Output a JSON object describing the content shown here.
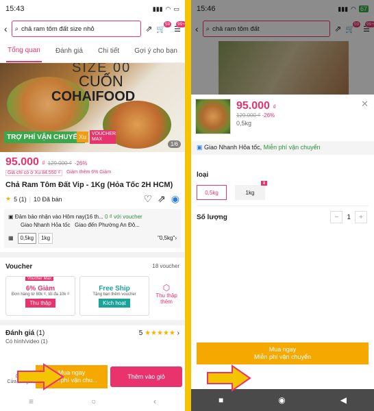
{
  "left": {
    "status_time": "15:43",
    "cart_badge": "59",
    "chat_badge": "99+",
    "search_text": "chả ram tôm đất size nhỏ",
    "tabs": [
      "Tổng quan",
      "Đánh giá",
      "Chi tiết",
      "Gợi ý cho bạn"
    ],
    "hero": {
      "size": "SIZE 00",
      "cuon": "CUỐN",
      "brand": "COHAIFOOD",
      "tro": "TRỢ PHÍ VẬN CHUYỂN",
      "xu": "Xu",
      "voucher": "VOUCHER MAX",
      "page": "1/6"
    },
    "price": "95.000",
    "currency": "₫",
    "old_price": "129.000 ₫",
    "discount": "-26%",
    "xu_note": "Giá chỉ có ở Xu 84.550 ₫",
    "extra_discount": "Giảm thêm 6% Giảm",
    "product_name": "Chả Ram Tôm Đất Vip - 1Kg (Hỏa Tốc 2H HCM)",
    "rating": "5 (1)",
    "sold": "10 Đã bán",
    "ship_line1": "Đảm bảo nhận vào Hôm nay(16 th...",
    "ship_fee": "0 ₫ với voucher",
    "ship_line2": "Giao Nhanh Hỏa tốc",
    "ship_dest": "Giao đến Phường An Đô...",
    "options": [
      "0,5kg",
      "1kg"
    ],
    "selected_option": "\"0,5kg\"",
    "voucher_title": "Voucher",
    "voucher_count": "18 voucher",
    "vouchers": [
      {
        "tag": "Voucher Max",
        "title": "6% Giảm",
        "desc": "Đơn hàng từ 80k ₫, tối đa 10k ₫",
        "btn": "Thu thập"
      },
      {
        "title": "Free Ship",
        "desc": "Tặng bạn thêm voucher",
        "btn": "Kích hoạt"
      }
    ],
    "collect_more": "Thu thập thêm",
    "review_title": "Đánh giá",
    "review_count": "(1)",
    "review_score": "5",
    "has_image": "Có hình/video (1)",
    "store": "Cửa hàng",
    "buy_now": "Mua ngay",
    "buy_sub": "Miễn phí vận chu...",
    "add_cart": "Thêm vào giỏ"
  },
  "right": {
    "status_time": "15:46",
    "battery": "67",
    "cart_badge": "59",
    "chat_badge": "99+",
    "search_text": "chả ram tôm đất",
    "price": "95.000",
    "currency": "₫",
    "old_price": "129.000 ₫",
    "discount": "-26%",
    "weight": "0,5kg",
    "ship": "Giao Nhanh Hỏa tốc,",
    "ship_free": "Miễn phí vận chuyển",
    "loai": "loại",
    "options": [
      "0,5kg",
      "1kg"
    ],
    "qty_label": "Số lượng",
    "qty": "1",
    "buy_now": "Mua ngay",
    "buy_sub": "Miễn phí vận chuyển"
  },
  "colors": {
    "accent": "#e8336d",
    "buy": "#f5a800",
    "background": "#f5c400",
    "ship_green": "#2a8f3a"
  }
}
